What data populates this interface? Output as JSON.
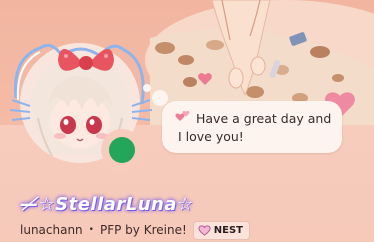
{
  "profile": {
    "display_name": "—̸☆StellarLuna☆",
    "username": "lunachann",
    "separator": "•",
    "pfp_credit": "PFP by Kreine!",
    "status": "online",
    "status_color": "#23a55a"
  },
  "custom_status": {
    "text": "Have a great day and I love you!",
    "emoji_icon": "pink-hearts-icon"
  },
  "badge": {
    "icon": "heart-badge-icon",
    "label": "NEST"
  },
  "colors": {
    "banner": "#f2b6a0",
    "panel": "#f7ccbd",
    "name_glow": "#8a6cf0"
  }
}
